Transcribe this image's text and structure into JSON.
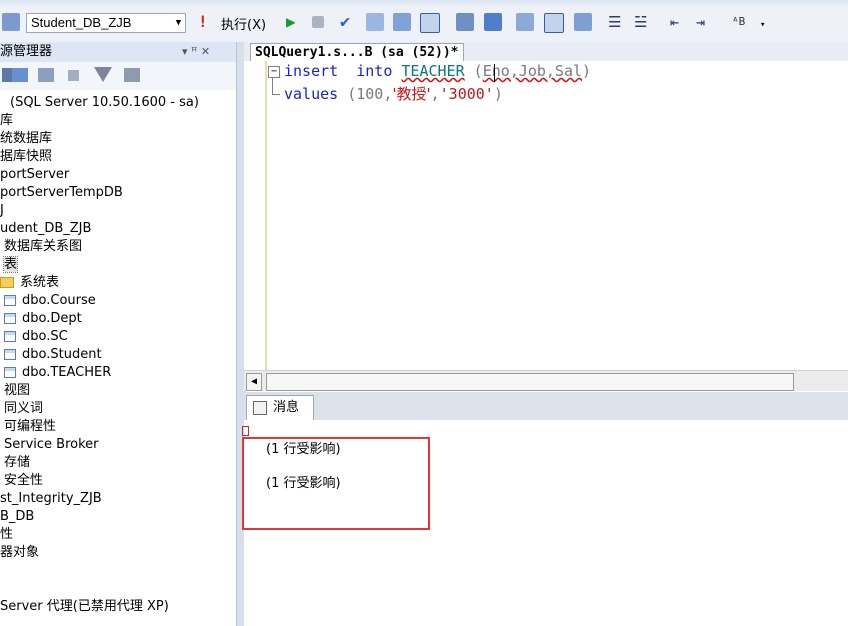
{
  "toolbar": {
    "database_selector": "Student_DB_ZJB",
    "execute_label": "执行(X)"
  },
  "object_explorer": {
    "title": "源管理器",
    "pin": "▾ ꟸ ✕",
    "tree": [
      {
        "text": "(SQL Server 10.50.1600 - sa)",
        "indent": 10,
        "icon": "none"
      },
      {
        "text": "库",
        "indent": 0,
        "icon": "none"
      },
      {
        "text": "统数据库",
        "indent": 0,
        "icon": "none"
      },
      {
        "text": "据库快照",
        "indent": 0,
        "icon": "none"
      },
      {
        "text": "portServer",
        "indent": 0,
        "icon": "none"
      },
      {
        "text": "portServerTempDB",
        "indent": 0,
        "icon": "none"
      },
      {
        "text": "J",
        "indent": 0,
        "icon": "none"
      },
      {
        "text": "udent_DB_ZJB",
        "indent": 0,
        "icon": "none"
      },
      {
        "text": "数据库关系图",
        "indent": 4,
        "icon": "none"
      },
      {
        "text": "表",
        "indent": 4,
        "icon": "none",
        "selected": true
      },
      {
        "text": "系统表",
        "indent": 0,
        "icon": "folder"
      },
      {
        "text": "dbo.Course",
        "indent": 4,
        "icon": "table"
      },
      {
        "text": "dbo.Dept",
        "indent": 4,
        "icon": "table"
      },
      {
        "text": "dbo.SC",
        "indent": 4,
        "icon": "table"
      },
      {
        "text": "dbo.Student",
        "indent": 4,
        "icon": "table"
      },
      {
        "text": "dbo.TEACHER",
        "indent": 4,
        "icon": "table"
      },
      {
        "text": "视图",
        "indent": 4,
        "icon": "none"
      },
      {
        "text": "同义词",
        "indent": 4,
        "icon": "none"
      },
      {
        "text": "可编程性",
        "indent": 4,
        "icon": "none"
      },
      {
        "text": "Service Broker",
        "indent": 4,
        "icon": "none"
      },
      {
        "text": "存储",
        "indent": 4,
        "icon": "none"
      },
      {
        "text": "安全性",
        "indent": 4,
        "icon": "none"
      },
      {
        "text": "st_Integrity_ZJB",
        "indent": 0,
        "icon": "none"
      },
      {
        "text": "B_DB",
        "indent": 0,
        "icon": "none"
      },
      {
        "text": "性",
        "indent": 0,
        "icon": "none"
      },
      {
        "text": "器对象",
        "indent": 0,
        "icon": "none"
      },
      {
        "text": "",
        "indent": 0,
        "icon": "none"
      },
      {
        "text": "",
        "indent": 0,
        "icon": "none"
      },
      {
        "text": "Server 代理(已禁用代理 XP)",
        "indent": 0,
        "icon": "none"
      }
    ]
  },
  "editor": {
    "tab_title": "SQLQuery1.s...B (sa (52))*",
    "line1": {
      "kw1": "insert",
      "kw2": "into",
      "table": "TEACHER",
      "open": "(",
      "cols": "Eno,Job,Sal",
      "close": ")"
    },
    "line2": {
      "kw": "values",
      "open": "(100,",
      "s1": "'教授'",
      "comma": ",",
      "s2": "'3000'",
      "close": ")"
    }
  },
  "results": {
    "tab_label": "消息",
    "messages": [
      "(1 行受影响)",
      "(1 行受影响)"
    ]
  },
  "colors": {
    "keyword": "#1a20d6",
    "string": "#c0181d",
    "highlight_box": "#e23535"
  }
}
